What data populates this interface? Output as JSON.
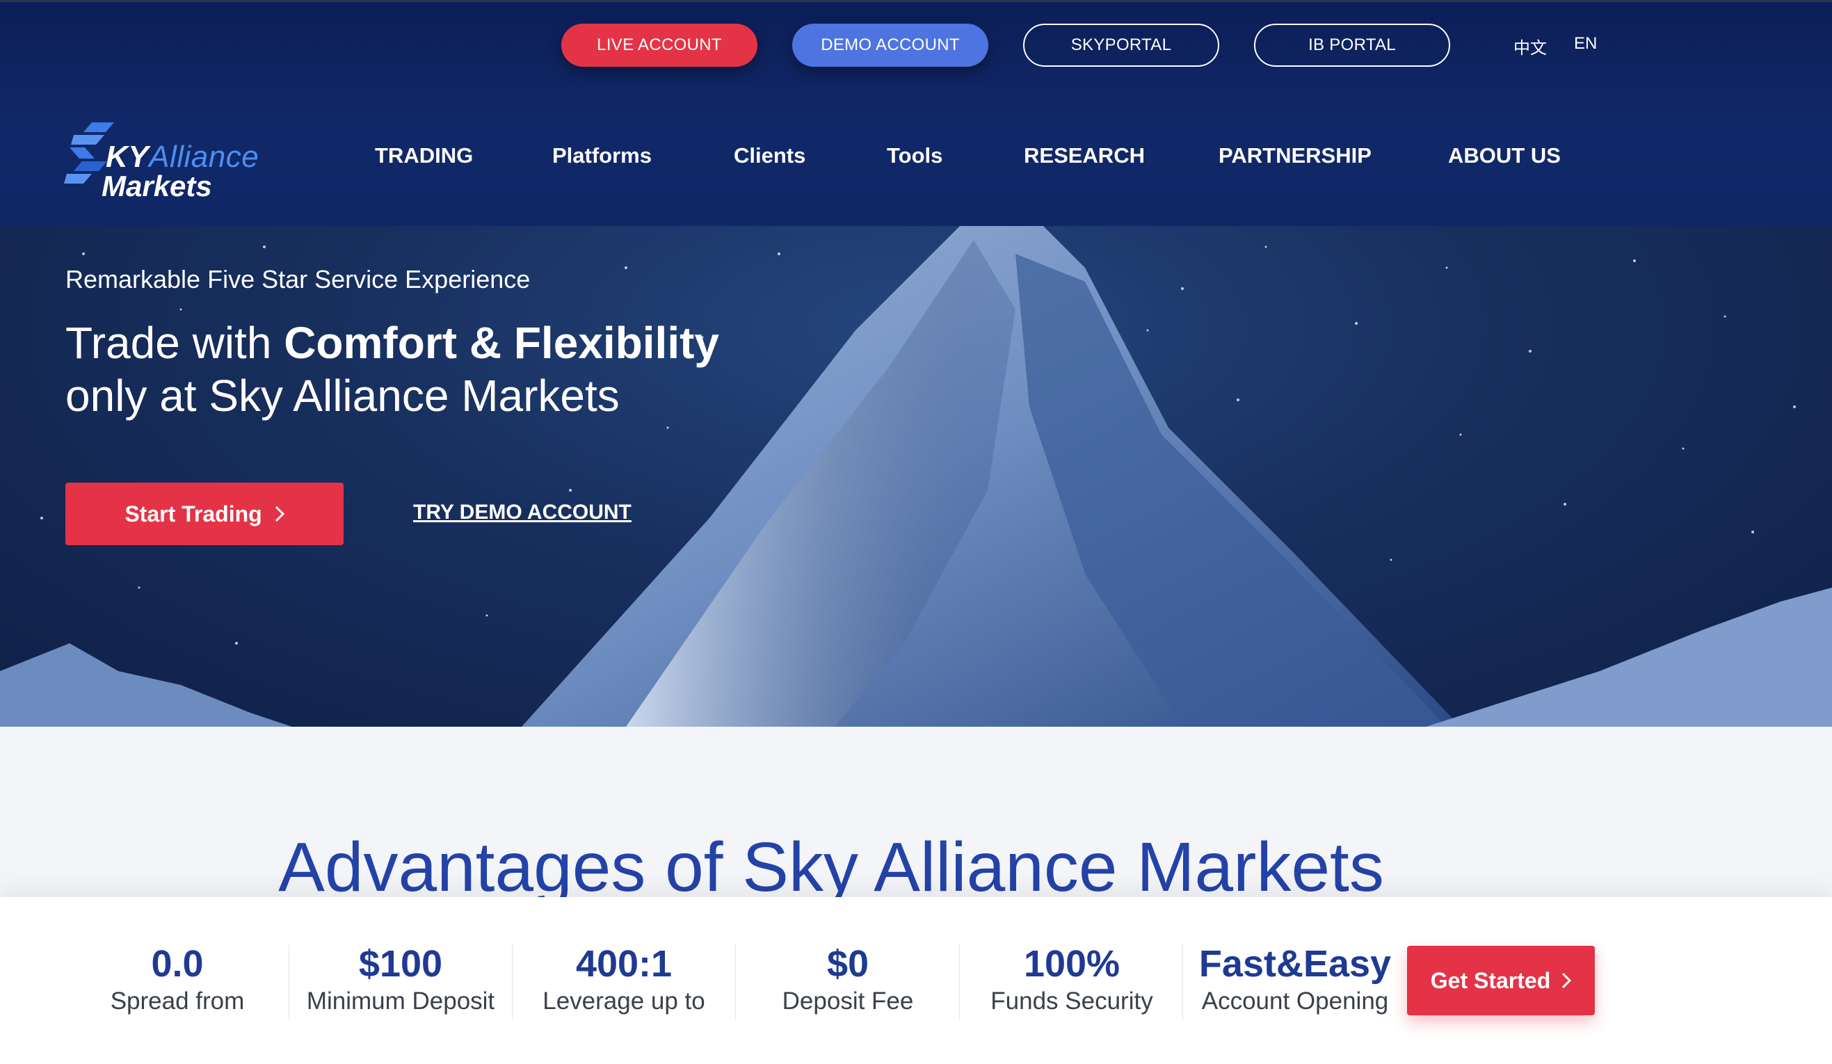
{
  "topbar": {
    "live_account": "LIVE ACCOUNT",
    "demo_account": "DEMO ACCOUNT",
    "skyportal": "SKYPORTAL",
    "ib_portal": "IB PORTAL",
    "lang_zh": "中文",
    "lang_en": "EN"
  },
  "logo": {
    "sky": "KY",
    "alliance": "Alliance",
    "markets": "Markets"
  },
  "nav": {
    "items": [
      {
        "label": "TRADING"
      },
      {
        "label": "Platforms"
      },
      {
        "label": "Clients"
      },
      {
        "label": "Tools"
      },
      {
        "label": "RESEARCH"
      },
      {
        "label": "PARTNERSHIP"
      },
      {
        "label": "ABOUT US"
      }
    ]
  },
  "hero": {
    "subtitle": "Remarkable Five Star Service Experience",
    "title_prefix": "Trade with ",
    "title_bold": "Comfort & Flexibility",
    "title_line2": "only at Sky Alliance Markets",
    "start_trading": "Start Trading",
    "try_demo": "TRY DEMO ACCOUNT"
  },
  "advantages": {
    "title": "Advantages of Sky Alliance Markets",
    "stats": [
      {
        "value": "0.0",
        "label": "Spread from"
      },
      {
        "value": "$100",
        "label": "Minimum Deposit"
      },
      {
        "value": "400:1",
        "label": "Leverage up to"
      },
      {
        "value": "$0",
        "label": "Deposit Fee"
      },
      {
        "value": "100%",
        "label": "Funds Security"
      },
      {
        "value": "Fast&Easy",
        "label": "Account Opening"
      }
    ],
    "get_started": "Get Started"
  },
  "colors": {
    "navy": "#112868",
    "accent_red": "#e43346",
    "accent_blue": "#4d74e0",
    "title_blue": "#2443a8"
  },
  "icons": {
    "chevron": "chevron-right-icon"
  }
}
